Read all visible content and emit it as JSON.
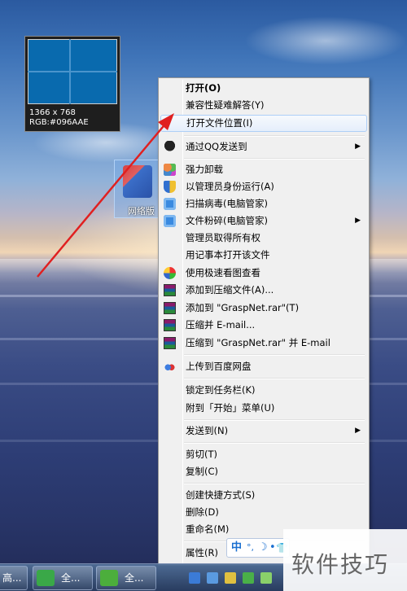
{
  "preview": {
    "size_text": "1366 x 768",
    "rgb_text": "RGB:#096AAE",
    "swatch_color": "#096AAE"
  },
  "desktop_icon": {
    "label": "网络版"
  },
  "context_menu": {
    "items": [
      {
        "label": "打开(O)",
        "bold": true
      },
      {
        "label": "兼容性疑难解答(Y)"
      },
      {
        "label": "打开文件位置(I)",
        "highlighted": true
      },
      {
        "label": "通过QQ发送到",
        "icon": "qq-icon",
        "submenu": true
      },
      {
        "label": "强力卸载",
        "icon": "uninstall-clover-icon"
      },
      {
        "label": "以管理员身份运行(A)",
        "icon": "uac-shield-icon"
      },
      {
        "label": "扫描病毒(电脑管家)",
        "icon": "pc-manager-icon"
      },
      {
        "label": "文件粉碎(电脑管家)",
        "icon": "pc-manager-icon",
        "submenu": true
      },
      {
        "label": "管理员取得所有权"
      },
      {
        "label": "用记事本打开该文件"
      },
      {
        "label": "使用极速看图查看",
        "icon": "image-viewer-icon"
      },
      {
        "label": "添加到压缩文件(A)...",
        "icon": "winrar-icon"
      },
      {
        "label": "添加到 \"GraspNet.rar\"(T)",
        "icon": "winrar-icon"
      },
      {
        "label": "压缩并 E-mail...",
        "icon": "winrar-icon"
      },
      {
        "label": "压缩到 \"GraspNet.rar\" 并 E-mail",
        "icon": "winrar-icon"
      },
      {
        "label": "上传到百度网盘",
        "icon": "baidu-netdisk-icon"
      },
      {
        "label": "锁定到任务栏(K)"
      },
      {
        "label": "附到「开始」菜单(U)"
      },
      {
        "label": "发送到(N)",
        "submenu": true
      },
      {
        "label": "剪切(T)"
      },
      {
        "label": "复制(C)"
      },
      {
        "label": "创建快捷方式(S)"
      },
      {
        "label": "删除(D)"
      },
      {
        "label": "重命名(M)"
      },
      {
        "label": "属性(R)"
      }
    ]
  },
  "ime_bar": {
    "mode": "中",
    "icons": [
      "°,",
      "☽",
      "•",
      "👕"
    ]
  },
  "taskbar": {
    "left_label": "高...",
    "btn1_label": "全...",
    "btn2_label": "全..."
  },
  "watermark": {
    "text": "软件技巧"
  }
}
